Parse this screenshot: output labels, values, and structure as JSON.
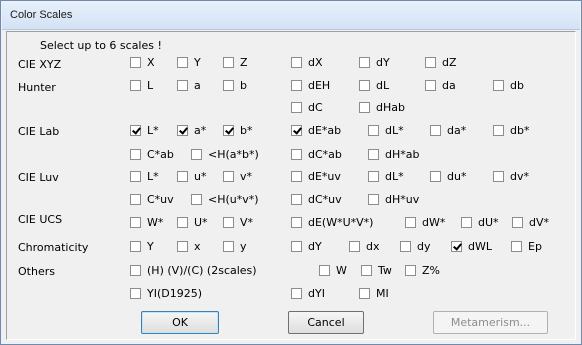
{
  "window": {
    "title": "Color Scales"
  },
  "instruction": "Select up to 6 scales !",
  "rows": [
    {
      "id": "cie-xyz",
      "label": "CIE XYZ",
      "items": [
        {
          "label": "X",
          "checked": false
        },
        {
          "label": "Y",
          "checked": false
        },
        {
          "label": "Z",
          "checked": false
        },
        {
          "label": "dX",
          "checked": false
        },
        {
          "label": "dY",
          "checked": false
        },
        {
          "label": "dZ",
          "checked": false
        }
      ]
    },
    {
      "id": "hunter",
      "label": "Hunter",
      "items": [
        {
          "label": "L",
          "checked": false
        },
        {
          "label": "a",
          "checked": false
        },
        {
          "label": "b",
          "checked": false
        },
        {
          "label": "dEH",
          "checked": false
        },
        {
          "label": "dL",
          "checked": false
        },
        {
          "label": "da",
          "checked": false
        },
        {
          "label": "db",
          "checked": false
        },
        {
          "label": "dC",
          "checked": false
        },
        {
          "label": "dHab",
          "checked": false
        }
      ]
    },
    {
      "id": "cie-lab",
      "label": "CIE Lab",
      "items": [
        {
          "label": "L*",
          "checked": true
        },
        {
          "label": "a*",
          "checked": true
        },
        {
          "label": "b*",
          "checked": true
        },
        {
          "label": "dE*ab",
          "checked": true
        },
        {
          "label": "dL*",
          "checked": false
        },
        {
          "label": "da*",
          "checked": false
        },
        {
          "label": "db*",
          "checked": false
        },
        {
          "label": "C*ab",
          "checked": false
        },
        {
          "label": "<H(a*b*)",
          "checked": false
        },
        {
          "label": "dC*ab",
          "checked": false
        },
        {
          "label": "dH*ab",
          "checked": false
        }
      ]
    },
    {
      "id": "cie-luv",
      "label": "CIE Luv",
      "items": [
        {
          "label": "L*",
          "checked": false
        },
        {
          "label": "u*",
          "checked": false
        },
        {
          "label": "v*",
          "checked": false
        },
        {
          "label": "dE*uv",
          "checked": false
        },
        {
          "label": "dL*",
          "checked": false
        },
        {
          "label": "du*",
          "checked": false
        },
        {
          "label": "dv*",
          "checked": false
        },
        {
          "label": "C*uv",
          "checked": false
        },
        {
          "label": "<H(u*v*)",
          "checked": false
        },
        {
          "label": "dC*uv",
          "checked": false
        },
        {
          "label": "dH*uv",
          "checked": false
        }
      ]
    },
    {
      "id": "cie-ucs",
      "label": "CIE UCS",
      "items": [
        {
          "label": "W*",
          "checked": false
        },
        {
          "label": "U*",
          "checked": false
        },
        {
          "label": "V*",
          "checked": false
        },
        {
          "label": "dE(W*U*V*)",
          "checked": false
        },
        {
          "label": "dW*",
          "checked": false
        },
        {
          "label": "dU*",
          "checked": false
        },
        {
          "label": "dV*",
          "checked": false
        }
      ]
    },
    {
      "id": "chromaticity",
      "label": "Chromaticity",
      "items": [
        {
          "label": "Y",
          "checked": false
        },
        {
          "label": "x",
          "checked": false
        },
        {
          "label": "y",
          "checked": false
        },
        {
          "label": "dY",
          "checked": false
        },
        {
          "label": "dx",
          "checked": false
        },
        {
          "label": "dy",
          "checked": false
        },
        {
          "label": "dWL",
          "checked": true
        },
        {
          "label": "Ep",
          "checked": false
        }
      ]
    },
    {
      "id": "others",
      "label": "Others",
      "items": [
        {
          "label": "(H) (V)/(C) (2scales)",
          "checked": false
        },
        {
          "label": "W",
          "checked": false
        },
        {
          "label": "Tw",
          "checked": false
        },
        {
          "label": "Z%",
          "checked": false
        },
        {
          "label": "YI(D1925)",
          "checked": false
        },
        {
          "label": "dYI",
          "checked": false
        },
        {
          "label": "MI",
          "checked": false
        }
      ]
    }
  ],
  "buttons": {
    "ok": "OK",
    "cancel": "Cancel",
    "metamerism": "Metamerism..."
  }
}
